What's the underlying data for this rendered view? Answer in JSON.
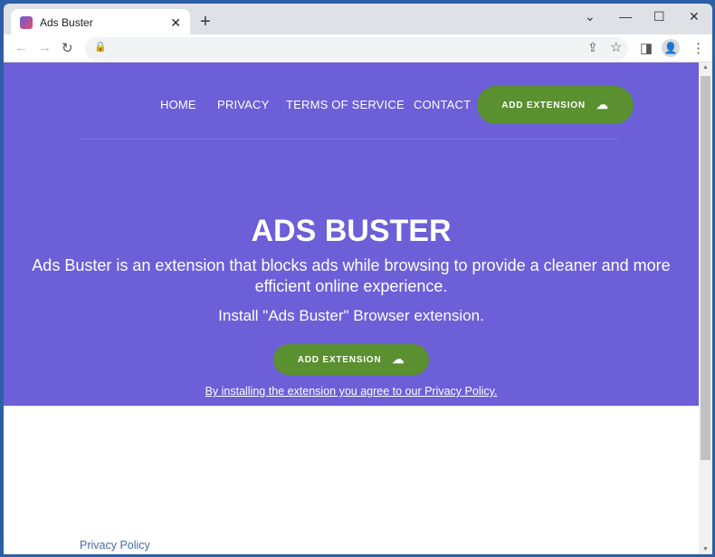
{
  "browser": {
    "tab_title": "Ads Buster",
    "new_tab": "+",
    "close_tab": "✕"
  },
  "nav": {
    "items": [
      "HOME",
      "PRIVACY",
      "TERMS OF SERVICE",
      "CONTACT"
    ],
    "cta": "ADD EXTENSION"
  },
  "hero": {
    "title": "ADS BUSTER",
    "description": "Ads Buster is an extension that blocks ads while browsing to provide a cleaner and more efficient online experience.",
    "install_text": "Install \"Ads Buster\" Browser extension.",
    "cta": "ADD EXTENSION",
    "agreement": "By installing the extension you agree to our Privacy Policy."
  },
  "footer": {
    "privacy_link": "Privacy Policy"
  },
  "colors": {
    "hero_bg": "#6c5fd8",
    "button": "#5a9030"
  }
}
